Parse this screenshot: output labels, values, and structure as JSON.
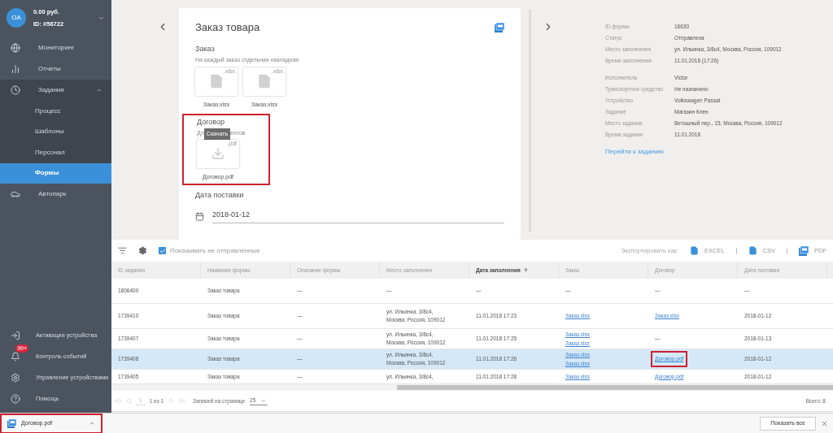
{
  "sidebar": {
    "account": {
      "initials": "OA",
      "balance": "0.00 руб.",
      "id": "ID: #56722"
    },
    "items": [
      {
        "label": "Мониторинг",
        "selected": false
      },
      {
        "label": "Отчеты",
        "selected": false
      },
      {
        "label": "Задания",
        "selected": false,
        "expanded": true,
        "children": [
          {
            "label": "Процесс",
            "selected": false
          },
          {
            "label": "Шаблоны",
            "selected": false
          },
          {
            "label": "Персонал",
            "selected": false
          },
          {
            "label": "Формы",
            "selected": true
          }
        ]
      },
      {
        "label": "Автопарк",
        "selected": false
      }
    ],
    "bottom_items": [
      {
        "label": "Активация устройства"
      },
      {
        "label": "Контроль событий",
        "badge": "99+"
      },
      {
        "label": "Управление устройствами"
      },
      {
        "label": "Помощь"
      }
    ]
  },
  "form": {
    "title": "Заказ товара",
    "order": {
      "heading": "Заказ",
      "hint": "На каждый заказ отдельная накладная",
      "files": [
        {
          "ext": ".xlsx",
          "name": "Заказ.xlsx"
        },
        {
          "ext": ".xlsx",
          "name": "Заказ.xlsx"
        }
      ]
    },
    "contract": {
      "heading": "Договор",
      "hint_start": "Дл",
      "hint_end": "ентов",
      "tooltip": "Скачать",
      "highlighted": true,
      "files": [
        {
          "ext": ".pdf",
          "name": "Договор.pdf"
        }
      ]
    },
    "delivery": {
      "heading": "Дата поставки",
      "value": "2018-01-12"
    }
  },
  "info": {
    "groups": [
      [
        {
          "label": "ID формы",
          "value": "16630"
        },
        {
          "label": "Статус",
          "value": "Отправлена"
        },
        {
          "label": "Место заполнения",
          "value": "ул. Ильинка, 3/8с4, Москва, Россия, 109012"
        },
        {
          "label": "Время заполнения",
          "value": "11.01.2018 (17:26)"
        }
      ],
      [
        {
          "label": "Исполнитель",
          "value": "Victor"
        },
        {
          "label": "Транспортное средство",
          "value": "Не назначено"
        },
        {
          "label": "Устройство",
          "value": "Volkswagen Passat"
        },
        {
          "label": "Задание",
          "value": "Магазин Клен"
        },
        {
          "label": "Место задания",
          "value": "Ветошный пер., 15, Москва, Россия, 109012"
        },
        {
          "label": "Время задания",
          "value": "11.01.2018"
        }
      ]
    ],
    "link": "Перейти к заданию"
  },
  "toolbar": {
    "show_unsent": {
      "label": "Показывать не отправленные",
      "checked": true
    },
    "export_label": "Экспортировать как:",
    "exports": [
      {
        "kind": "plain",
        "label": "EXCEL"
      },
      {
        "kind": "plain",
        "label": "CSV"
      },
      {
        "kind": "pdf",
        "label": "PDF"
      }
    ]
  },
  "table": {
    "columns": [
      {
        "label": "ID задания",
        "sorted": false
      },
      {
        "label": "Название формы",
        "sorted": false
      },
      {
        "label": "Описание формы",
        "sorted": false
      },
      {
        "label": "Место заполнения",
        "sorted": false
      },
      {
        "label": "Дата заполнения",
        "sorted": true
      },
      {
        "label": "Заказ",
        "sorted": false
      },
      {
        "label": "Договор",
        "sorted": false
      },
      {
        "label": "Дата поставки",
        "sorted": false
      }
    ],
    "rows": [
      {
        "selected": false,
        "cells": [
          {
            "text": [
              "1806400"
            ]
          },
          {
            "text": [
              "Заказ товара"
            ]
          },
          {
            "text": [
              "—"
            ]
          },
          {
            "text": [
              "—"
            ]
          },
          {
            "text": [
              "—"
            ]
          },
          {
            "text": [
              "—"
            ]
          },
          {
            "text": [
              "—"
            ]
          },
          {
            "text": [
              "—"
            ]
          }
        ]
      },
      {
        "selected": false,
        "cells": [
          {
            "text": [
              "1739410"
            ]
          },
          {
            "text": [
              "Заказ товара"
            ]
          },
          {
            "text": [
              "—"
            ]
          },
          {
            "text": [
              "ул. Ильинка, 3/8с4,",
              "Москва, Россия, 109012"
            ]
          },
          {
            "text": [
              "11.01.2018 17:23"
            ]
          },
          {
            "links": [
              "Заказ.xlsx"
            ]
          },
          {
            "links": [
              "Заказ.xlsx"
            ]
          },
          {
            "text": [
              "2018-01-12"
            ]
          }
        ]
      },
      {
        "selected": false,
        "cells": [
          {
            "text": [
              "1739407"
            ]
          },
          {
            "text": [
              "Заказ товара"
            ]
          },
          {
            "text": [
              "—"
            ]
          },
          {
            "text": [
              "ул. Ильинка, 3/8с4,",
              "Москва, Россия, 109012"
            ]
          },
          {
            "text": [
              "11.01.2018 17:25"
            ]
          },
          {
            "links": [
              "Заказ.xlsx",
              "Заказ.xlsx"
            ]
          },
          {
            "text": [
              "—"
            ]
          },
          {
            "text": [
              "2018-01-13"
            ]
          }
        ]
      },
      {
        "selected": true,
        "cells": [
          {
            "text": [
              "1739408"
            ]
          },
          {
            "text": [
              "Заказ товара"
            ]
          },
          {
            "text": [
              "—"
            ]
          },
          {
            "text": [
              "ул. Ильинка, 3/8с4,",
              "Москва, Россия, 109012"
            ]
          },
          {
            "text": [
              "11.01.2018 17:26"
            ]
          },
          {
            "links": [
              "Заказ.xlsx",
              "Заказ.xlsx"
            ]
          },
          {
            "links": [
              "Договор.pdf"
            ],
            "highlighted": true
          },
          {
            "text": [
              "2018-01-12"
            ]
          }
        ]
      },
      {
        "selected": false,
        "cells": [
          {
            "text": [
              "1739405"
            ]
          },
          {
            "text": [
              "Заказ товара"
            ]
          },
          {
            "text": [
              "—"
            ]
          },
          {
            "text": [
              "ул. Ильинка, 3/8с4,"
            ]
          },
          {
            "text": [
              "11.01.2018 17:28"
            ]
          },
          {
            "links": [
              "Заказ.xlsx"
            ]
          },
          {
            "links": [
              "Договор.pdf"
            ]
          },
          {
            "text": [
              "2018-01-12"
            ]
          }
        ]
      }
    ]
  },
  "pagination": {
    "page": "1",
    "of": "1 из 1",
    "per_page_label": "Записей на странице",
    "per_page": "25",
    "total": "Всего: 8"
  },
  "downloads": {
    "file": "Договор.pdf",
    "highlighted": true,
    "show_all": "Показать все"
  }
}
